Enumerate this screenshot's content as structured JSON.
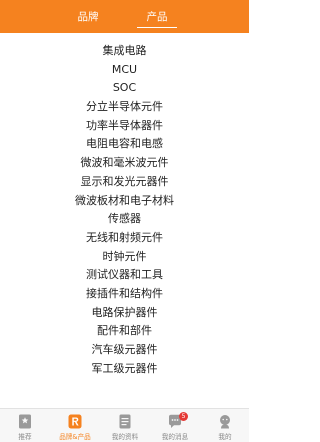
{
  "header": {
    "tabs": [
      {
        "label": "品牌"
      },
      {
        "label": "产品"
      }
    ],
    "active_tab": 1
  },
  "categories": [
    "集成电路",
    "MCU",
    "SOC",
    "分立半导体元件",
    "功率半导体器件",
    "电阻电容和电感",
    "微波和毫米波元件",
    "显示和发光元器件",
    "微波板材和电子材料",
    "传感器",
    "无线和射频元件",
    "时钟元件",
    "测试仪器和工具",
    "接插件和结构件",
    "电路保护器件",
    "配件和部件",
    "汽车级元器件",
    "军工级元器件"
  ],
  "tabbar": {
    "items": [
      {
        "label": "推荐",
        "icon": "bookmark-icon"
      },
      {
        "label": "品牌&产品",
        "icon": "r-logo-icon"
      },
      {
        "label": "我的资料",
        "icon": "document-icon"
      },
      {
        "label": "我的消息",
        "icon": "chat-icon",
        "badge": "5"
      },
      {
        "label": "我的",
        "icon": "person-icon"
      }
    ],
    "active_index": 1
  },
  "colors": {
    "accent": "#f5821f",
    "tab_inactive": "#8a8a8a",
    "badge": "#e53935"
  }
}
